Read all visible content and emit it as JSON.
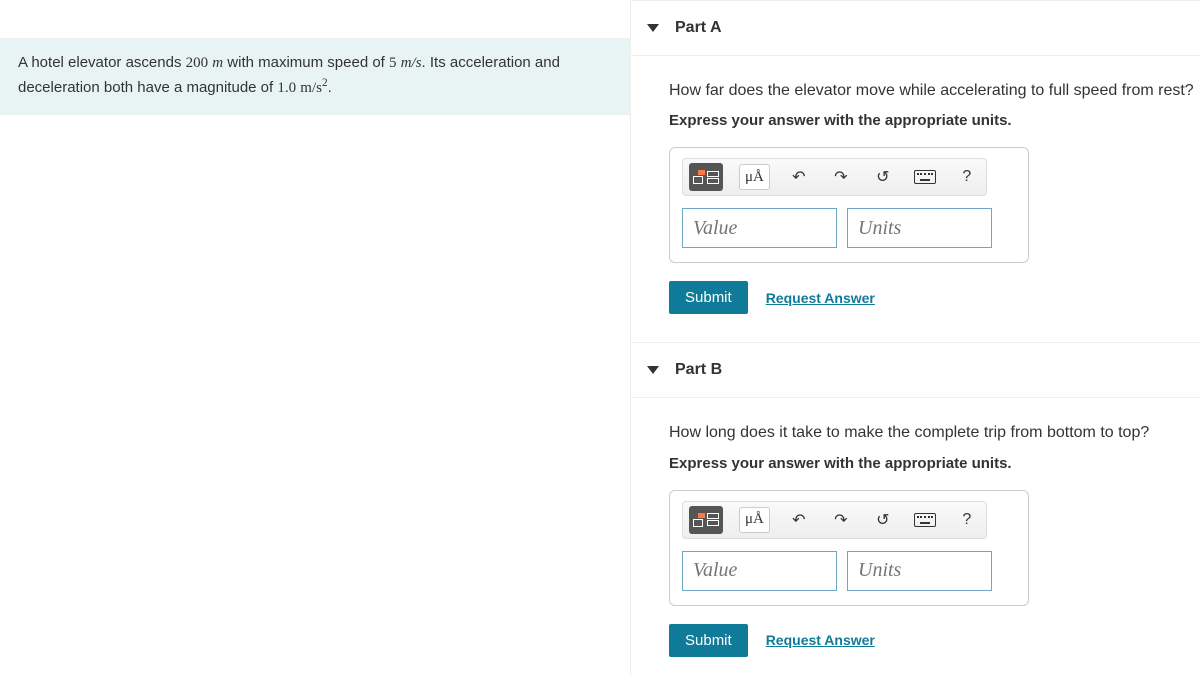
{
  "problem": {
    "text_before_d": "A hotel elevator ascends ",
    "distance_val": "200",
    "distance_unit": "m",
    "text_mid1": " with maximum speed of ",
    "speed_val": "5",
    "speed_unit": "m/s",
    "text_mid2": ". Its acceleration and deceleration both have a magnitude of ",
    "accel_val": "1.0",
    "accel_unit_base": "m/s",
    "accel_unit_exp": "2",
    "text_end": "."
  },
  "partA": {
    "title": "Part A",
    "question": "How far does the elevator move while accelerating to full speed from rest?",
    "instruction": "Express your answer with the appropriate units.",
    "toolbar": {
      "mu": "μÅ",
      "undo": "↶",
      "redo": "↷",
      "reset": "↺",
      "help": "?"
    },
    "value_placeholder": "Value",
    "units_placeholder": "Units",
    "submit": "Submit",
    "request": "Request Answer"
  },
  "partB": {
    "title": "Part B",
    "question": "How long does it take to make the complete trip from bottom to top?",
    "instruction": "Express your answer with the appropriate units.",
    "toolbar": {
      "mu": "μÅ",
      "undo": "↶",
      "redo": "↷",
      "reset": "↺",
      "help": "?"
    },
    "value_placeholder": "Value",
    "units_placeholder": "Units",
    "submit": "Submit",
    "request": "Request Answer"
  }
}
